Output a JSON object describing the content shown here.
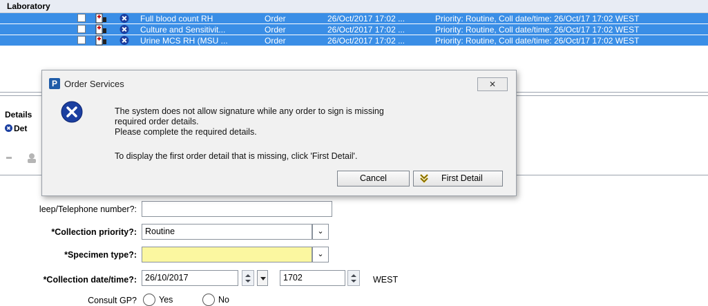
{
  "laboratory": {
    "header": "Laboratory",
    "rows": [
      {
        "name": "Full blood count RH",
        "type": "Order",
        "datetime": "26/Oct/2017 17:02 ...",
        "details": "Priority: Routine, Coll date/time: 26/Oct/17 17:02 WEST"
      },
      {
        "name": "Culture and Sensitivit...",
        "type": "Order",
        "datetime": "26/Oct/2017 17:02 ...",
        "details": "Priority: Routine, Coll date/time: 26/Oct/17 17:02 WEST"
      },
      {
        "name": "Urine MCS RH (MSU ...",
        "type": "Order",
        "datetime": "26/Oct/2017 17:02 ...",
        "details": "Priority: Routine, Coll date/time: 26/Oct/17 17:02 WEST"
      }
    ],
    "row_bg_color": "#3a8ee6"
  },
  "details_panel": {
    "title": "Details",
    "tab": "Det"
  },
  "form": {
    "bleep_label": "leep/Telephone number?:",
    "bleep_value": "",
    "priority_label": "*Collection priority?:",
    "priority_value": "Routine",
    "specimen_label": "*Specimen type?:",
    "specimen_value": "",
    "collection_label": "*Collection date/time?:",
    "collection_date": "26/10/2017",
    "collection_time": "1702",
    "timezone": "WEST",
    "consult_label": "Consult GP?",
    "consult_yes": "Yes",
    "consult_no": "No"
  },
  "dialog": {
    "title": "Order Services",
    "title_icon_letter": "P",
    "close_label": "✕",
    "message_line1": "The system does not allow signature while any order to sign is missing",
    "message_line2": "required order details.",
    "message_line3": "Please complete the required details.",
    "message_line4": "To display the first order detail that is missing, click 'First Detail'.",
    "cancel_label": "Cancel",
    "first_detail_label": "First Detail",
    "error_icon": "error-x-icon"
  }
}
